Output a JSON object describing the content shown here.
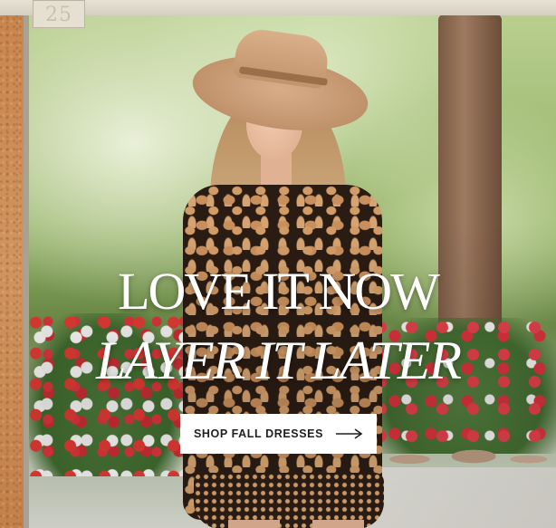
{
  "banner": {
    "date_tag": "25",
    "headline_line1": "LOVE IT NOW",
    "headline_line2": "LAYER IT LATER",
    "cta_label": "SHOP FALL DRESSES",
    "cta_icon": "arrow-right-icon"
  },
  "colors": {
    "cork": "#c98a55",
    "headline": "#ffffff",
    "cta_background": "#ffffff",
    "cta_text": "#1f1f1f"
  }
}
